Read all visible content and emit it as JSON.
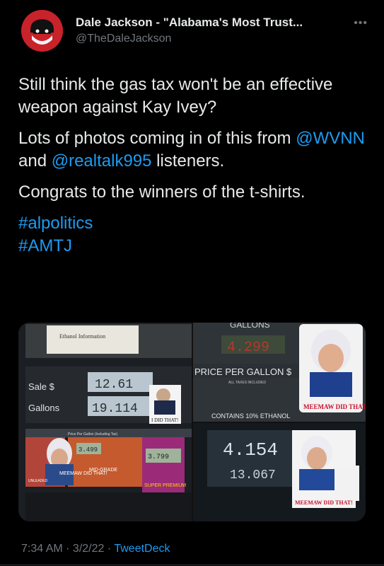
{
  "author": {
    "display_name": "Dale Jackson - \"Alabama's Most Trust...",
    "handle": "@TheDaleJackson",
    "more_label": "•••"
  },
  "tweet": {
    "line1": "Still think the gas tax won't be an effective weapon against Kay Ivey?",
    "line2_pre": "Lots of photos coming in of this from ",
    "mention1": "@WVNN",
    "line2_mid": " and ",
    "mention2": "@realtalk995",
    "line2_post": " listeners.",
    "line3": "Congrats to the winners of the t-shirts.",
    "hashtag1": "#alpolitics",
    "hashtag2": "#AMTJ"
  },
  "photos": {
    "p1": {
      "ethanol_title": "Ethanol Information",
      "sale_label": "Sale $",
      "sale_value": "12.61",
      "gallons_label": "Gallons",
      "gallons_value": "19.114",
      "sticker_text": "I DID THAT!",
      "price_strip": "Price Per Gallon (Including Tax)",
      "price_mid": "3.499",
      "price_right": "3.799",
      "grade_unleaded": "UNLEADED",
      "grade_mid": "MID-GRADE",
      "grade_premium": "SUPER PREMIUM",
      "sticker_meemaw": "MEEMAW DID THAT!"
    },
    "p2": {
      "gallons_label": "GALLONS",
      "price_value": "4.299",
      "price_per_gallon": "PRICE PER GALLON $",
      "taxes": "ALL TAXES INCLUDED",
      "ethanol": "CONTAINS 10% ETHANOL",
      "sticker_meemaw": "MEEMAW DID THAT!"
    },
    "p3": {
      "price_value": "4.154",
      "second_value": "13.067",
      "sticker_meemaw": "MEEMAW DID THAT!"
    }
  },
  "footer": {
    "time": "7:34 AM",
    "separator1": " · ",
    "date": "3/2/22",
    "separator2": " · ",
    "source": "TweetDeck"
  },
  "colors": {
    "background": "#000000",
    "text": "#e7e9ea",
    "muted": "#71767b",
    "link": "#1d9bf0",
    "avatar_red": "#c8222a"
  }
}
